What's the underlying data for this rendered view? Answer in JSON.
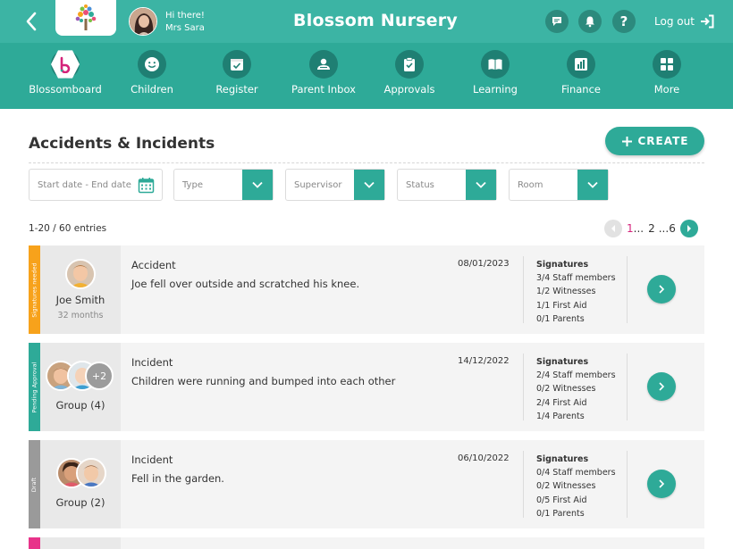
{
  "header": {
    "greeting": "Hi there!",
    "user_name": "Mrs Sara",
    "app_title": "Blossom Nursery",
    "logout_label": "Log out"
  },
  "nav": {
    "items": [
      {
        "label": "Blossomboard",
        "icon": "blossomboard-logo-icon"
      },
      {
        "label": "Children",
        "icon": "smiley-icon"
      },
      {
        "label": "Register",
        "icon": "register-icon"
      },
      {
        "label": "Parent Inbox",
        "icon": "parent-inbox-icon"
      },
      {
        "label": "Approvals",
        "icon": "clipboard-check-icon"
      },
      {
        "label": "Learning",
        "icon": "book-icon"
      },
      {
        "label": "Finance",
        "icon": "chart-icon"
      },
      {
        "label": "More",
        "icon": "grid-icon"
      }
    ]
  },
  "page": {
    "title": "Accidents & Incidents",
    "create_label": "CREATE"
  },
  "filters": {
    "date_placeholder": "Start date - End date",
    "type": "Type",
    "supervisor": "Supervisor",
    "status": "Status",
    "room": "Room"
  },
  "list": {
    "entries": "1-20 / 60 entries",
    "pagination": {
      "current": "1",
      "ellipsis1": "...",
      "page2": "2",
      "ellipsis2": "...",
      "last": "6"
    },
    "signatures_heading": "Signatures",
    "cards": [
      {
        "status": "Signatures needed",
        "status_color": "#f7a21b",
        "name": "Joe Smith",
        "age": "32 months",
        "type": "Accident",
        "description": "Joe fell over outside and scratched his knee.",
        "date": "08/01/2023",
        "signatures": [
          "3/4 Staff members",
          "1/2 Witnesses",
          "1/1 First Aid",
          "0/1 Parents"
        ]
      },
      {
        "status": "Pending Approval",
        "status_color": "#2eaa98",
        "name": "Group (4)",
        "more": "+2",
        "type": "Incident",
        "description": "Children were running and bumped into each other",
        "date": "14/12/2022",
        "signatures": [
          "2/4 Staff members",
          "0/2 Witnesses",
          "2/4 First Aid",
          "1/4 Parents"
        ]
      },
      {
        "status": "Draft",
        "status_color": "#9a9a9a",
        "name": "Group (2)",
        "type": "Incident",
        "description": "Fell in the garden.",
        "date": "06/10/2022",
        "signatures": [
          "0/4 Staff members",
          "0/2 Witnesses",
          "0/5 First Aid",
          "0/1 Parents"
        ]
      }
    ]
  },
  "colors": {
    "primary": "#2eaa98",
    "header": "#3cb4a4",
    "accent": "#d4237a"
  }
}
